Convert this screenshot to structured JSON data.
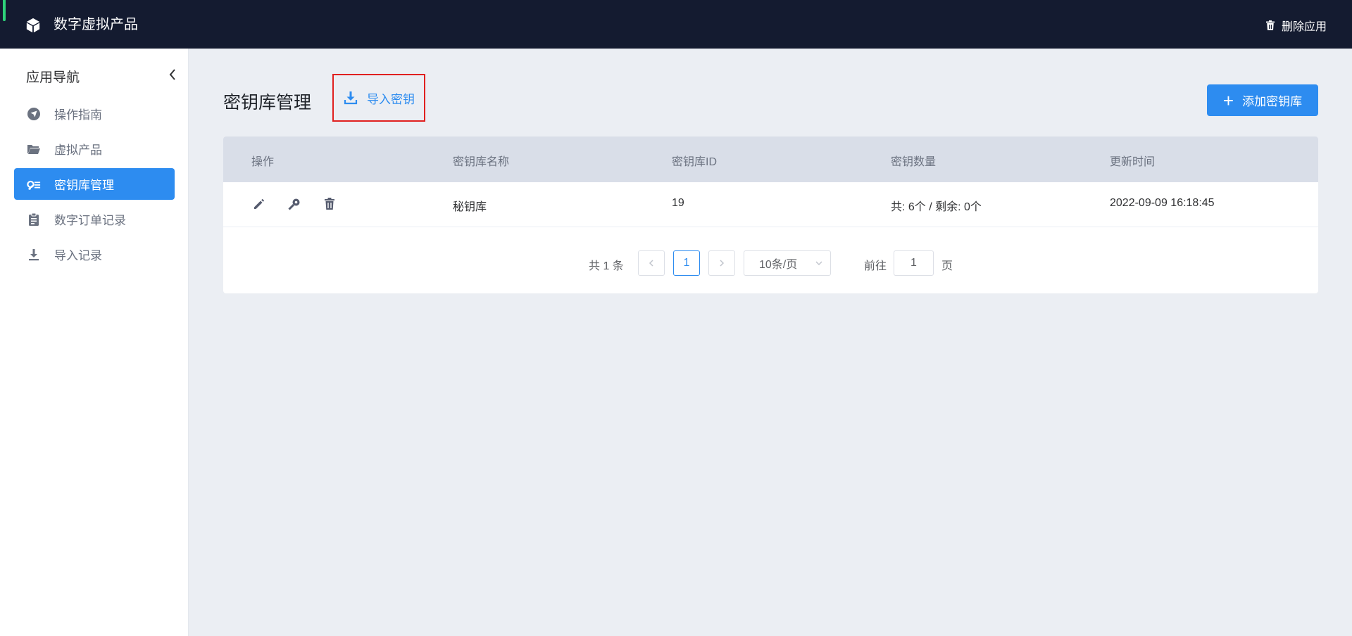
{
  "topbar": {
    "app_title": "数字虚拟产品",
    "delete_label": "删除应用"
  },
  "sidebar": {
    "title": "应用导航",
    "items": [
      {
        "label": "操作指南",
        "icon": "navigation-icon",
        "active": false
      },
      {
        "label": "虚拟产品",
        "icon": "folder-icon",
        "active": false
      },
      {
        "label": "密钥库管理",
        "icon": "key-list-icon",
        "active": true
      },
      {
        "label": "数字订单记录",
        "icon": "clipboard-icon",
        "active": false
      },
      {
        "label": "导入记录",
        "icon": "download-icon",
        "active": false
      }
    ]
  },
  "main": {
    "page_title": "密钥库管理",
    "import_label": "导入密钥",
    "add_label": "添加密钥库"
  },
  "table": {
    "columns": [
      "操作",
      "密钥库名称",
      "密钥库ID",
      "密钥数量",
      "更新时间"
    ],
    "rows": [
      {
        "name": "秘钥库",
        "id": "19",
        "count": "共: 6个 / 剩余: 0个",
        "updated": "2022-09-09 16:18:45"
      }
    ]
  },
  "pagination": {
    "total": "共 1 条",
    "current_page": "1",
    "page_size": "10条/页",
    "goto_label": "前往",
    "goto_value": "1",
    "page_suffix": "页"
  },
  "colors": {
    "topbar_bg": "#141b30",
    "accent": "#2d8cf0",
    "highlight_border": "#e0201f"
  }
}
